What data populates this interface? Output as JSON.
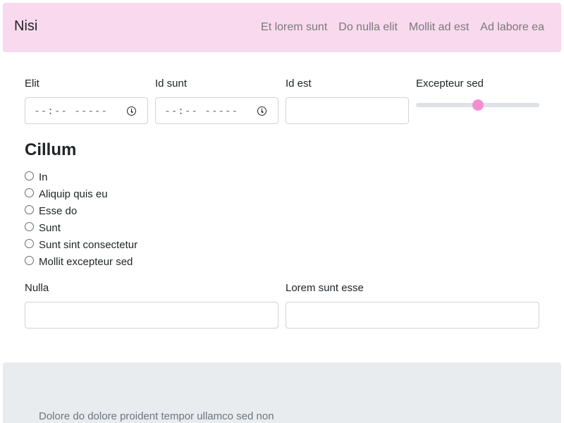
{
  "navbar": {
    "brand": "Nisi",
    "links": [
      "Et lorem sunt",
      "Do nulla elit",
      "Mollit ad est",
      "Ad labore ea"
    ]
  },
  "form": {
    "fields": {
      "elit": {
        "label": "Elit",
        "value": "--:-- -----"
      },
      "id_sunt": {
        "label": "Id sunt",
        "value": "--:-- -----"
      },
      "id_est": {
        "label": "Id est",
        "value": ""
      },
      "excepteur_sed": {
        "label": "Excepteur sed",
        "value_fraction": 0.5
      },
      "nulla": {
        "label": "Nulla",
        "value": ""
      },
      "lorem_sunt_esse": {
        "label": "Lorem sunt esse",
        "value": ""
      }
    },
    "radio_group": {
      "title": "Cillum",
      "options": [
        "In",
        "Aliquip quis eu",
        "Esse do",
        "Sunt",
        "Sunt sint consectetur",
        "Mollit excepteur sed"
      ]
    }
  },
  "footer": {
    "text": "Dolore do dolore proident tempor ullamco sed non"
  },
  "colors": {
    "navbar_bg": "#f8d9ee",
    "slider_thumb": "#f48ed2",
    "footer_bg": "#e9ecef"
  }
}
